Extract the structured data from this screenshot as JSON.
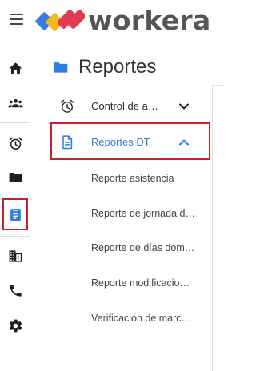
{
  "header": {
    "brand_name": "workera"
  },
  "rail": {
    "items": [
      {
        "icon": "home-icon"
      },
      {
        "icon": "people-icon"
      },
      {
        "icon": "alarm-icon"
      },
      {
        "icon": "folder-icon"
      },
      {
        "icon": "clipboard-icon"
      },
      {
        "icon": "building-icon"
      },
      {
        "icon": "phone-icon"
      },
      {
        "icon": "gear-icon"
      }
    ],
    "active_item": "clipboard-icon"
  },
  "panel": {
    "title": "Reportes",
    "title_icon": "folder-icon",
    "menu": [
      {
        "label": "Control de a…",
        "icon": "alarm-icon",
        "expanded": false
      },
      {
        "label": "Reportes DT",
        "icon": "document-icon",
        "expanded": true
      }
    ],
    "subitems": [
      "Reporte asistencia",
      "Reporte de jornada d…",
      "Reporte de días dom…",
      "Reporte modificacio…",
      "Verificación de marc…"
    ]
  },
  "colors": {
    "accent_blue": "#2f7be5",
    "highlight_red": "#c7202c",
    "logo_blue": "#3a7be0",
    "logo_yellow": "#f5b820",
    "logo_red": "#e23a52"
  }
}
